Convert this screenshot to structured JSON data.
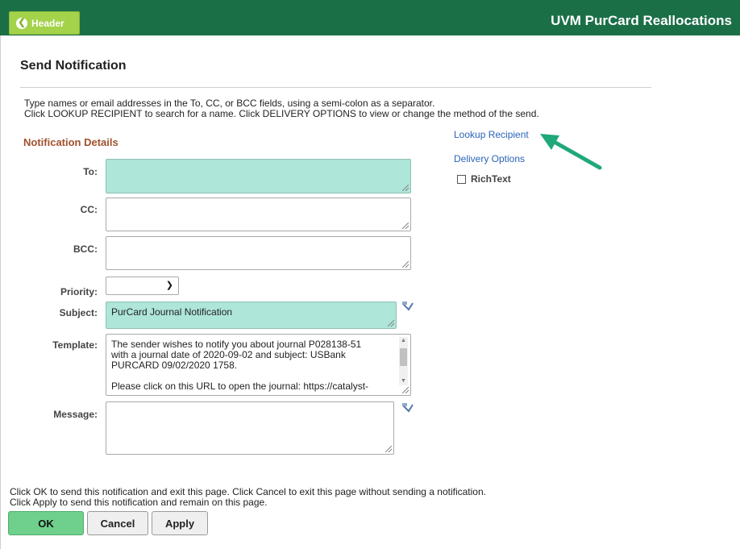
{
  "header": {
    "back_label": "Header",
    "app_title": "UVM PurCard Reallocations"
  },
  "page": {
    "title": "Send Notification",
    "instruction_line1": "Type names or email addresses in the To, CC, or BCC fields, using a semi-colon as a separator.",
    "instruction_line2": "Click LOOKUP RECIPIENT to search for a name.  Click DELIVERY OPTIONS to view or change the method of the send.",
    "section_title": "Notification Details"
  },
  "form": {
    "to_label": "To:",
    "to_value": "",
    "cc_label": "CC:",
    "cc_value": "",
    "bcc_label": "BCC:",
    "bcc_value": "",
    "priority_label": "Priority:",
    "priority_value": "",
    "subject_label": "Subject:",
    "subject_value": "PurCard Journal Notification",
    "template_label": "Template:",
    "template_lines": [
      "The sender wishes to notify you about journal P028138-51",
      "with a journal date of 2020-09-02 and subject: USBank",
      "PURCARD 09/02/2020 1758.",
      "",
      "Please click on this URL to open the journal: https://catalyst-"
    ],
    "message_label": "Message:",
    "message_value": ""
  },
  "side": {
    "lookup_recipient": "Lookup Recipient",
    "delivery_options": "Delivery Options",
    "richtext_label": "RichText",
    "richtext_checked": false
  },
  "footer": {
    "line1": "Click OK to send this notification and exit this page.  Click Cancel to exit this page without sending a notification.",
    "line2": "Click Apply to send this notification and remain on this page.",
    "ok_label": "OK",
    "cancel_label": "Cancel",
    "apply_label": "Apply"
  },
  "colors": {
    "topbar": "#1b6f47",
    "header_button": "#a4d24a",
    "required_field": "#aee6d9",
    "section_title": "#a0522d",
    "link": "#2a64b8",
    "ok_button": "#6fcf8c",
    "annotation_arrow": "#1fa87a"
  }
}
